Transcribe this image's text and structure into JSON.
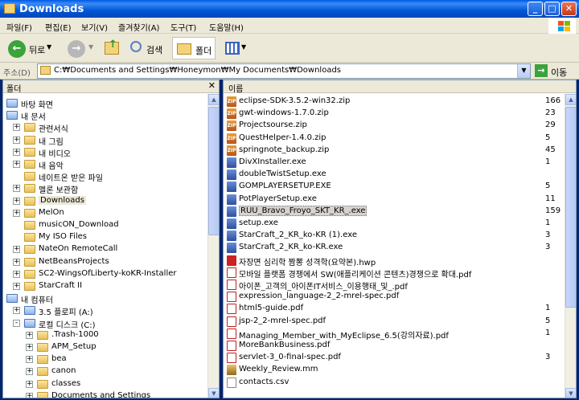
{
  "window": {
    "title": "Downloads"
  },
  "menu": [
    "파일(F)",
    "편집(E)",
    "보기(V)",
    "즐겨찾기(A)",
    "도구(T)",
    "도움말(H)"
  ],
  "toolbar": {
    "back": "뒤로",
    "search": "검색",
    "folders": "폴더"
  },
  "address": {
    "label": "주소(D)",
    "path": "C:₩Documents and Settings₩Honeymon₩My Documents₩Downloads",
    "go": "이동"
  },
  "left_panel": {
    "header": "폴더",
    "items": [
      {
        "label": "바탕 화면"
      },
      {
        "label": "내 문서"
      },
      {
        "label": "관련서식"
      },
      {
        "label": "내 그림"
      },
      {
        "label": "내 비디오"
      },
      {
        "label": "내 음악"
      },
      {
        "label": "네이트온 받은 파일"
      },
      {
        "label": "멜론 보관함"
      },
      {
        "label": "Downloads"
      },
      {
        "label": "MelOn"
      },
      {
        "label": "musicON_Download"
      },
      {
        "label": "My ISO Files"
      },
      {
        "label": "NateOn RemoteCall"
      },
      {
        "label": "NetBeansProjects"
      },
      {
        "label": "SC2-WingsOfLiberty-koKR-Installer"
      },
      {
        "label": "StarCraft II"
      },
      {
        "label": "내 컴퓨터"
      },
      {
        "label": "3.5 플로피 (A:)"
      },
      {
        "label": "로컬 디스크 (C:)"
      },
      {
        "label": ".Trash-1000"
      },
      {
        "label": "APM_Setup"
      },
      {
        "label": "bea"
      },
      {
        "label": "canon"
      },
      {
        "label": "classes"
      },
      {
        "label": "Documents and Settings"
      }
    ]
  },
  "right_panel": {
    "header": "이름",
    "files": [
      {
        "name": "eclipse-SDK-3.5.2-win32.zip",
        "size": "166",
        "type": "zip"
      },
      {
        "name": "gwt-windows-1.7.0.zip",
        "size": "23",
        "type": "zip"
      },
      {
        "name": "Projectsourse.zip",
        "size": "29",
        "type": "zip"
      },
      {
        "name": "QuestHelper-1.4.0.zip",
        "size": "5",
        "type": "zip"
      },
      {
        "name": "springnote_backup.zip",
        "size": "45",
        "type": "zip"
      },
      {
        "name": "DivXInstaller.exe",
        "size": "1",
        "type": "exe"
      },
      {
        "name": "doubleTwistSetup.exe",
        "size": "",
        "type": "exe"
      },
      {
        "name": "GOMPLAYERSETUP.EXE",
        "size": "5",
        "type": "exe"
      },
      {
        "name": "PotPlayerSetup.exe",
        "size": "11",
        "type": "exe"
      },
      {
        "name": "RUU_Bravo_Froyo_SKT_KR_.exe",
        "size": "159",
        "type": "exe",
        "selected": true
      },
      {
        "name": "setup.exe",
        "size": "1",
        "type": "exe"
      },
      {
        "name": "StarCraft_2_KR_ko-KR (1).exe",
        "size": "3",
        "type": "exe"
      },
      {
        "name": "StarCraft_2_KR_ko-KR.exe",
        "size": "3",
        "type": "exe"
      },
      {
        "name": "자장면 심리학 짬뽕 성격학(요약본).hwp",
        "size": "",
        "type": "hwp"
      },
      {
        "name": "모바일 플랫폼 경쟁에서 SW(애플리케이션 콘텐츠)경쟁으로 확대.pdf",
        "size": "",
        "type": "pdf"
      },
      {
        "name": "아이폰_고객의_아이폰IT서비스_이용행태_및_.pdf",
        "size": "",
        "type": "pdf"
      },
      {
        "name": "expression_language-2_2-mrel-spec.pdf",
        "size": "",
        "type": "pdf"
      },
      {
        "name": "html5-guide.pdf",
        "size": "1",
        "type": "pdf"
      },
      {
        "name": "jsp-2_2-mrel-spec.pdf",
        "size": "5",
        "type": "pdf"
      },
      {
        "name": "Managing_Member_with_MyEclipse_6.5(강의자료).pdf",
        "size": "1",
        "type": "pdf"
      },
      {
        "name": "MoreBankBusiness.pdf",
        "size": "",
        "type": "pdf"
      },
      {
        "name": "servlet-3_0-final-spec.pdf",
        "size": "3",
        "type": "pdf"
      },
      {
        "name": "Weekly_Review.mm",
        "size": "",
        "type": "mm"
      },
      {
        "name": "contacts.csv",
        "size": "",
        "type": "doc"
      }
    ]
  }
}
